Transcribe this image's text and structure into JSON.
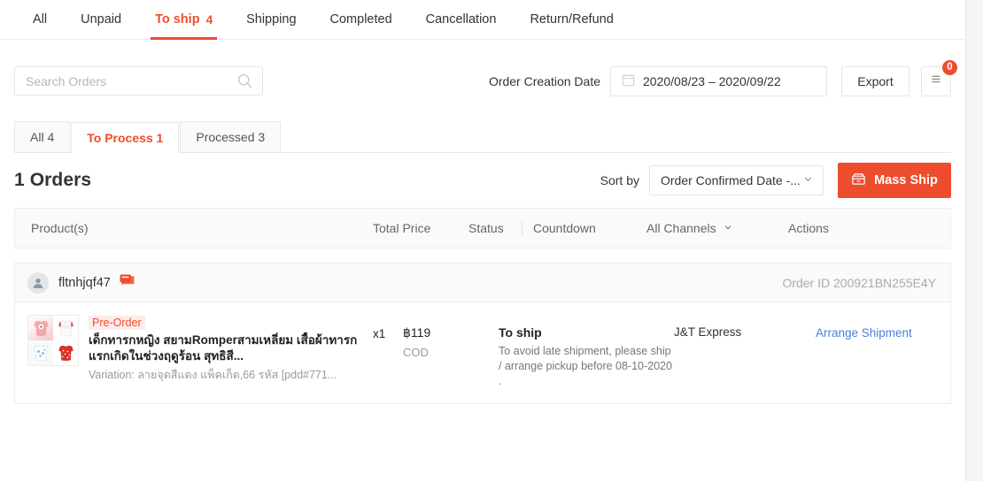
{
  "status_tabs": [
    {
      "label": "All",
      "count": "",
      "active": false
    },
    {
      "label": "Unpaid",
      "count": "",
      "active": false
    },
    {
      "label": "To ship",
      "count": "4",
      "active": true
    },
    {
      "label": "Shipping",
      "count": "",
      "active": false
    },
    {
      "label": "Completed",
      "count": "",
      "active": false
    },
    {
      "label": "Cancellation",
      "count": "",
      "active": false
    },
    {
      "label": "Return/Refund",
      "count": "",
      "active": false
    }
  ],
  "search": {
    "placeholder": "Search Orders",
    "value": "",
    "icon": "search-icon"
  },
  "filters": {
    "date_label": "Order Creation Date",
    "date_value": "2020/08/23 – 2020/09/22",
    "calendar_icon": "calendar-icon",
    "export_label": "Export",
    "list_icon": "document-list-icon",
    "list_badge": "0"
  },
  "sub_tabs": [
    {
      "label": "All 4",
      "active": false
    },
    {
      "label": "To Process 1",
      "active": true
    },
    {
      "label": "Processed 3",
      "active": false
    }
  ],
  "orders_summary": {
    "title": "1 Orders",
    "sort_label": "Sort by",
    "sort_value": "Order Confirmed Date -...",
    "chevron_icon": "chevron-down-icon",
    "mass_ship_label": "Mass Ship",
    "mass_ship_icon": "box-icon"
  },
  "table": {
    "columns": {
      "product": "Product(s)",
      "total_price": "Total Price",
      "status": "Status",
      "countdown": "Countdown",
      "channel": "All Channels",
      "channel_icon": "chevron-down-icon",
      "actions": "Actions"
    }
  },
  "orders": [
    {
      "buyer": "fltnhjqf47",
      "avatar_icon": "user-avatar-icon",
      "chat_icon": "chat-bubble-icon",
      "order_id": "Order ID 200921BN255E4Y",
      "items": [
        {
          "tag": "Pre-Order",
          "name": "เด็กทารกหญิง สยามRomperสามเหลี่ยม เสื้อผ้าทารกแรกเกิดในช่วงฤดูร้อน สุทธิสี...",
          "variation": "Variation: ลายจุดสีแดง แพ็คเก็ต,66 รหัส [pdd#771...",
          "qty": "x1",
          "price": "฿119",
          "payment": "COD",
          "status": "To ship",
          "status_note": "To avoid late shipment, please ship / arrange pickup before 08-10-2020 .",
          "channel": "J&T Express",
          "action": "Arrange Shipment"
        }
      ]
    }
  ],
  "colors": {
    "accent": "#ee4d2d",
    "link": "#4a7fe0",
    "header_bg": "#fafafa",
    "border": "#eeeeee"
  }
}
